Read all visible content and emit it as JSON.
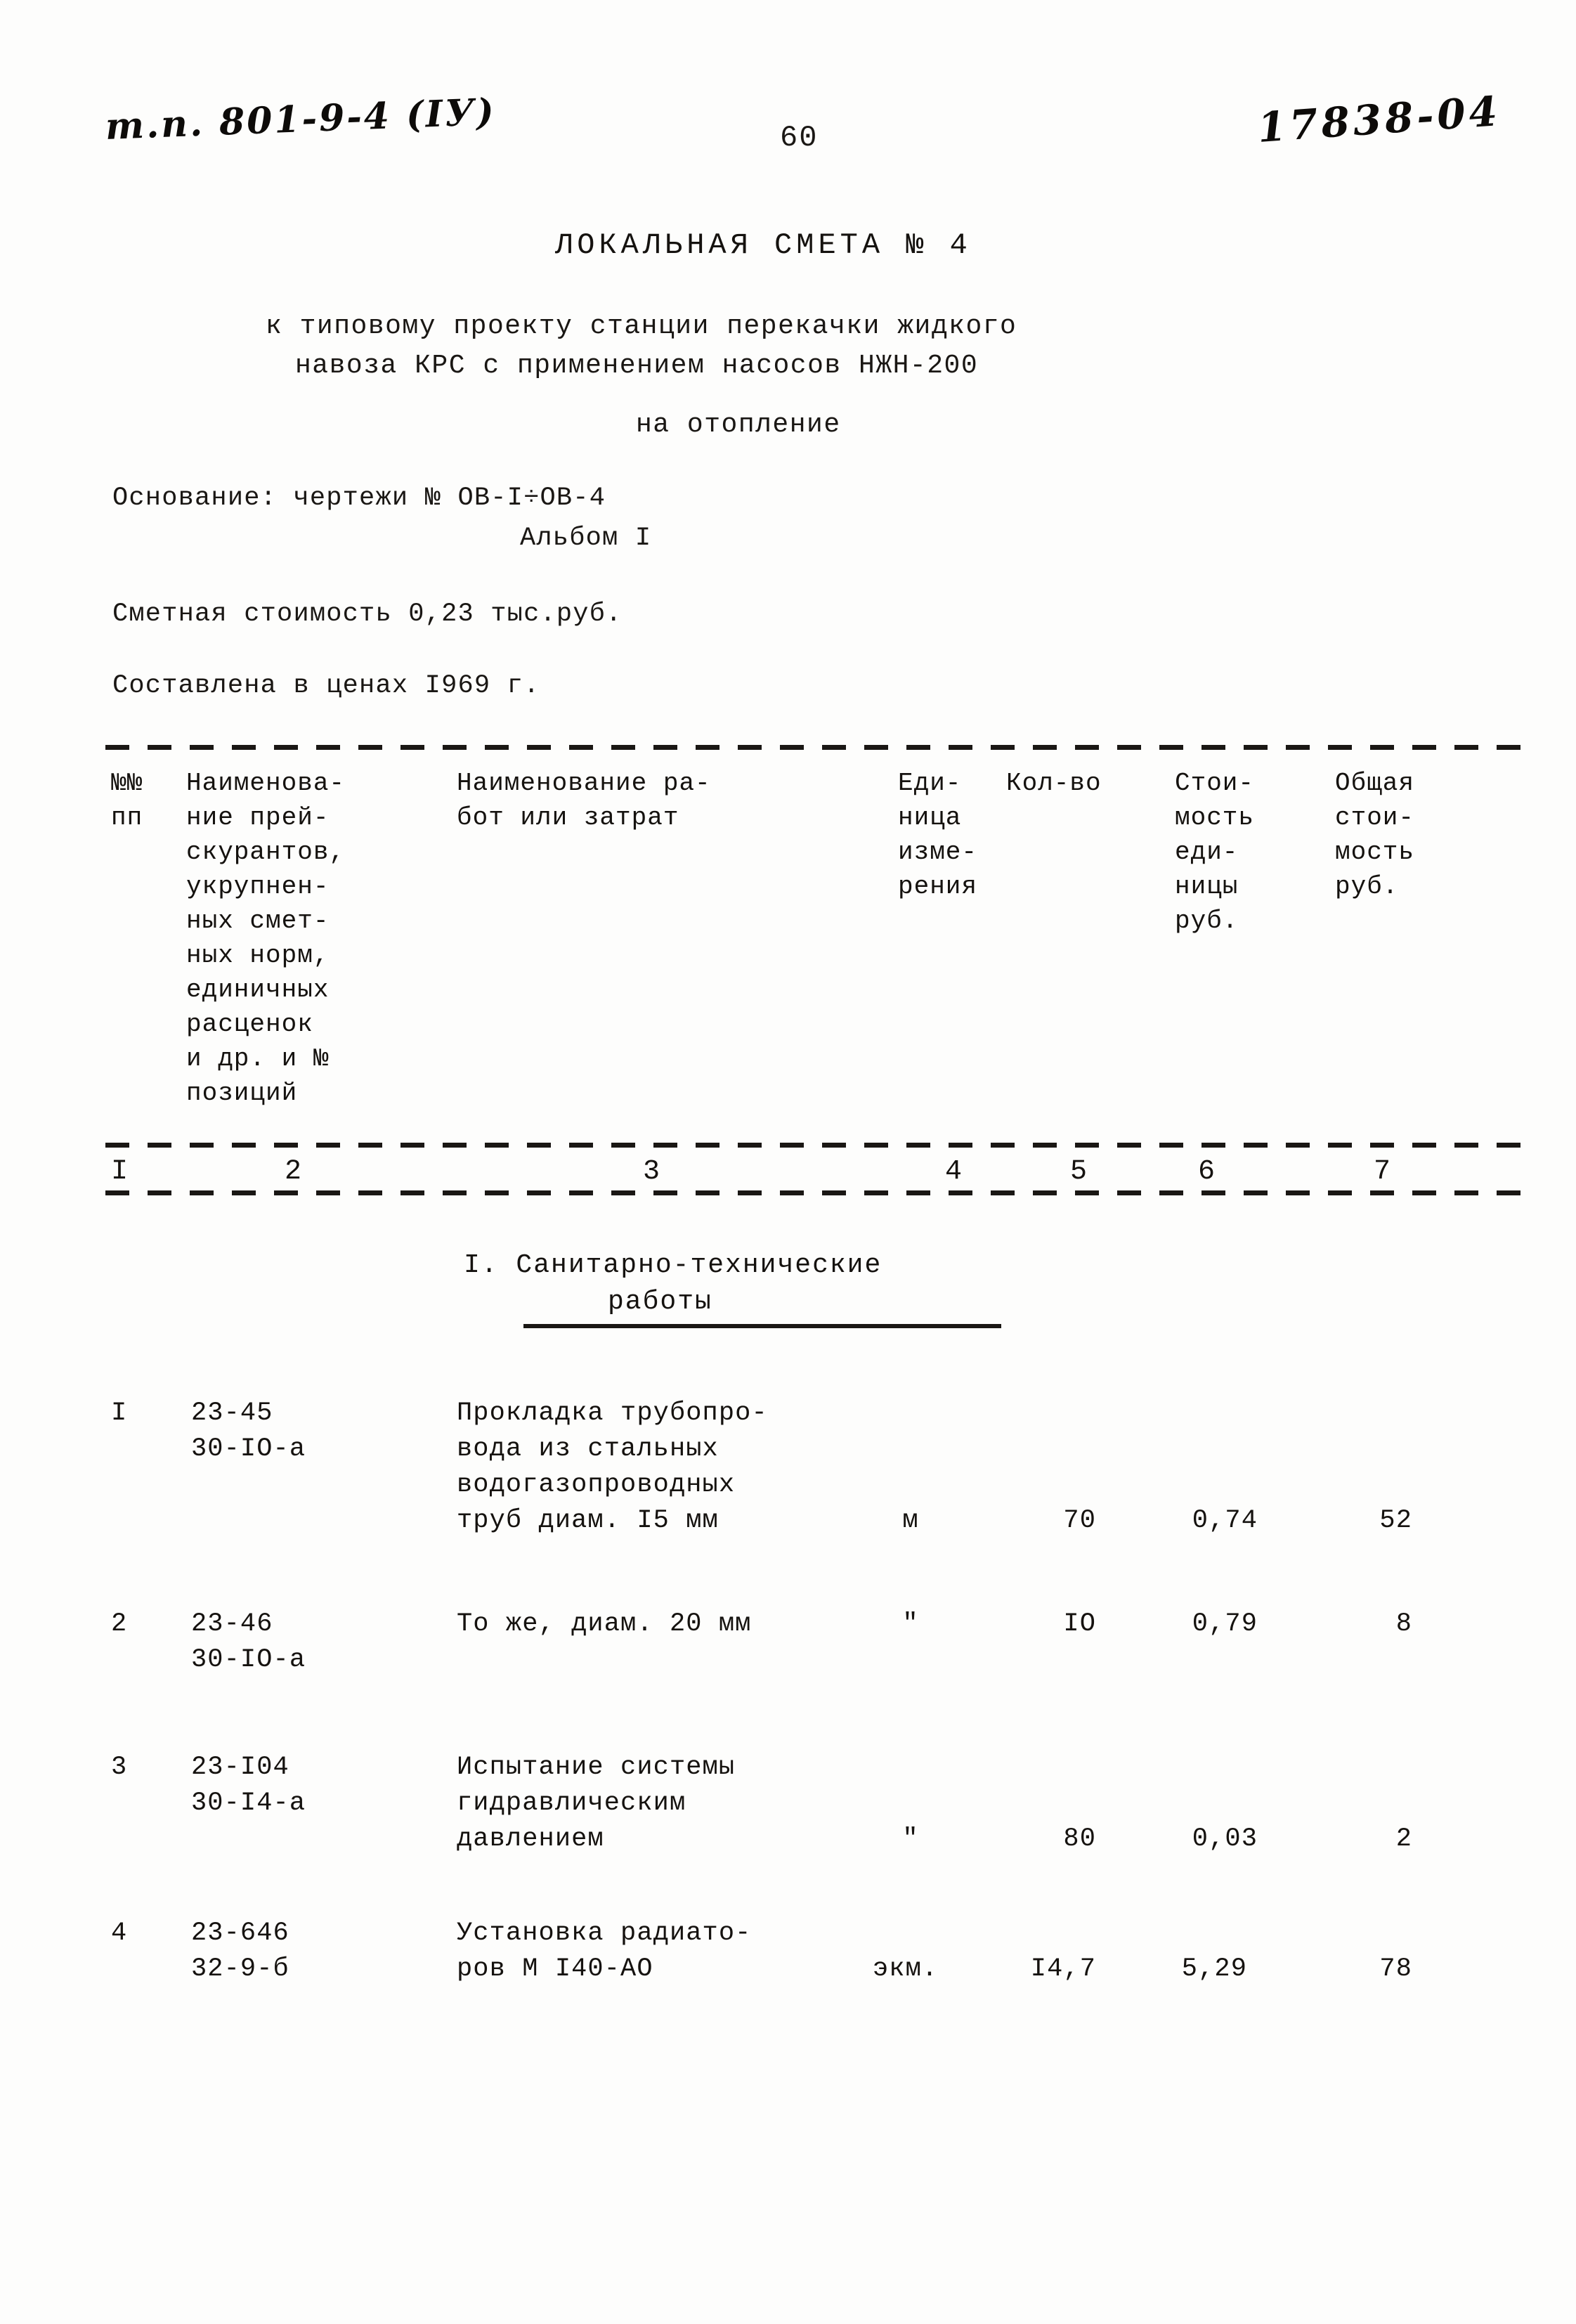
{
  "header": {
    "project_code": "т.п. 801-9-4 (IУ)",
    "page_number": "60",
    "archive_stamp": "17838-04"
  },
  "title": {
    "main": "ЛОКАЛЬНАЯ СМЕТА № 4",
    "subtitle_line1": "к типовому проекту станции перекачки жидкого",
    "subtitle_line2": "навоза КРС с применением насосов НЖН-200",
    "subtitle_line3": "на отопление"
  },
  "meta": {
    "basis_label": "Основание: чертежи № ОВ-I÷ОВ-4",
    "basis_line2": "Альбом I",
    "estimate_cost": "Сметная стоимость 0,23 тыс.руб.",
    "price_basis": "Составлена в ценах I969 г."
  },
  "table": {
    "headers": {
      "col1": "№№\nпп",
      "col2": "Наименова-\nние прей-\nскурантов,\nукрупнен-\nных смет-\nных норм,\nединичных\nрасценок\nи др. и №\nпозиций",
      "col3": "Наименование ра-\nбот или затрат",
      "col4": "Еди-\nница\nизме-\nрения",
      "col5": "Кол-во",
      "col6": "Стои-\nмость\nеди-\nницы\nруб.",
      "col7": "Общая\nстои-\nмость\nруб."
    },
    "column_numbers": [
      "I",
      "2",
      "3",
      "4",
      "5",
      "6",
      "7"
    ],
    "section_title_line1": "I. Санитарно-технические",
    "section_title_line2": "работы",
    "rows": [
      {
        "no": "I",
        "code": "23-45\n30-IO-а",
        "description": "Прокладка трубопро-\nвода из стальных\nводогазопроводных\nтруб диам. I5 мм",
        "unit": "м",
        "qty": "70",
        "unit_cost": "0,74",
        "total_cost": "52"
      },
      {
        "no": "2",
        "code": "23-46\n30-IO-а",
        "description": "То же, диам. 20 мм",
        "unit": "\"",
        "qty": "IO",
        "unit_cost": "0,79",
        "total_cost": "8"
      },
      {
        "no": "3",
        "code": "23-I04\n30-I4-а",
        "description": "Испытание системы\nгидравлическим\nдавлением",
        "unit": "\"",
        "qty": "80",
        "unit_cost": "0,03",
        "total_cost": "2"
      },
      {
        "no": "4",
        "code": "23-646\n32-9-б",
        "description": "Установка радиато-\nров М I40-АО",
        "unit": "экм.",
        "qty": "I4,7",
        "unit_cost": "5,29",
        "total_cost": "78"
      }
    ]
  }
}
